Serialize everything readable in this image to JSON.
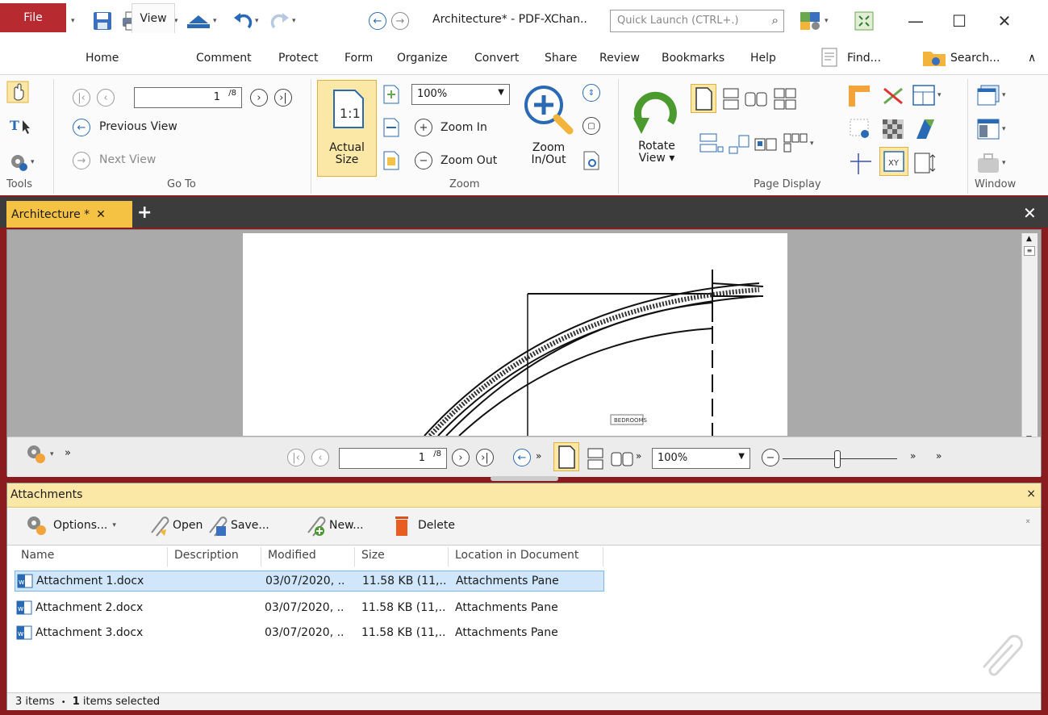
{
  "window": {
    "title": "Architecture* - PDF-XChan..",
    "quick_launch_placeholder": "Quick Launch (CTRL+.)"
  },
  "ribbon_tabs": [
    "File",
    "Home",
    "View",
    "Comment",
    "Protect",
    "Form",
    "Organize",
    "Convert",
    "Share",
    "Review",
    "Bookmarks",
    "Help"
  ],
  "ribbon_right": {
    "find": "Find...",
    "search": "Search..."
  },
  "goto": {
    "page_value": "1",
    "page_total": "/8",
    "previous_view": "Previous View",
    "next_view": "Next View",
    "label": "Go To"
  },
  "tools": {
    "label": "Tools"
  },
  "zoom": {
    "actual_size": "Actual Size",
    "actual_size_line1": "Actual",
    "actual_size_line2": "Size",
    "one_to_one": "1:1",
    "zoom_value": "100%",
    "zoom_in": "Zoom In",
    "zoom_out": "Zoom Out",
    "zoom_inout_line1": "Zoom",
    "zoom_inout_line2": "In/Out",
    "label": "Zoom"
  },
  "page_display": {
    "rotate_line1": "Rotate",
    "rotate_line2": "View",
    "label": "Page Display"
  },
  "window_group": {
    "label": "Window"
  },
  "doc_tab": {
    "label": "Architecture *"
  },
  "page_content": {
    "bedrooms_label": "BEDROOMS"
  },
  "navbar": {
    "page_value": "1",
    "page_total": "/8",
    "zoom_value": "100%"
  },
  "attachments": {
    "title": "Attachments",
    "toolbar": {
      "options": "Options...",
      "open": "Open",
      "save": "Save...",
      "new": "New...",
      "delete": "Delete"
    },
    "columns": [
      "Name",
      "Description",
      "Modified",
      "Size",
      "Location in Document"
    ],
    "rows": [
      {
        "name": "Attachment 1.docx",
        "description": "",
        "modified": "03/07/2020, ..",
        "size": "11.58 KB (11,..",
        "location": "Attachments Pane",
        "selected": true
      },
      {
        "name": "Attachment  2.docx",
        "description": "",
        "modified": "03/07/2020, ..",
        "size": "11.58 KB (11,..",
        "location": "Attachments Pane",
        "selected": false
      },
      {
        "name": "Attachment  3.docx",
        "description": "",
        "modified": "03/07/2020, ..",
        "size": "11.58 KB (11,..",
        "location": "Attachments Pane",
        "selected": false
      }
    ],
    "status_count": "3 items",
    "status_sep": "•",
    "status_selected_num": "1",
    "status_selected_text": "items selected"
  },
  "colors": {
    "accent_red": "#b72a30",
    "tab_yellow": "#f6c243",
    "selection_blue": "#cfe6fb"
  }
}
